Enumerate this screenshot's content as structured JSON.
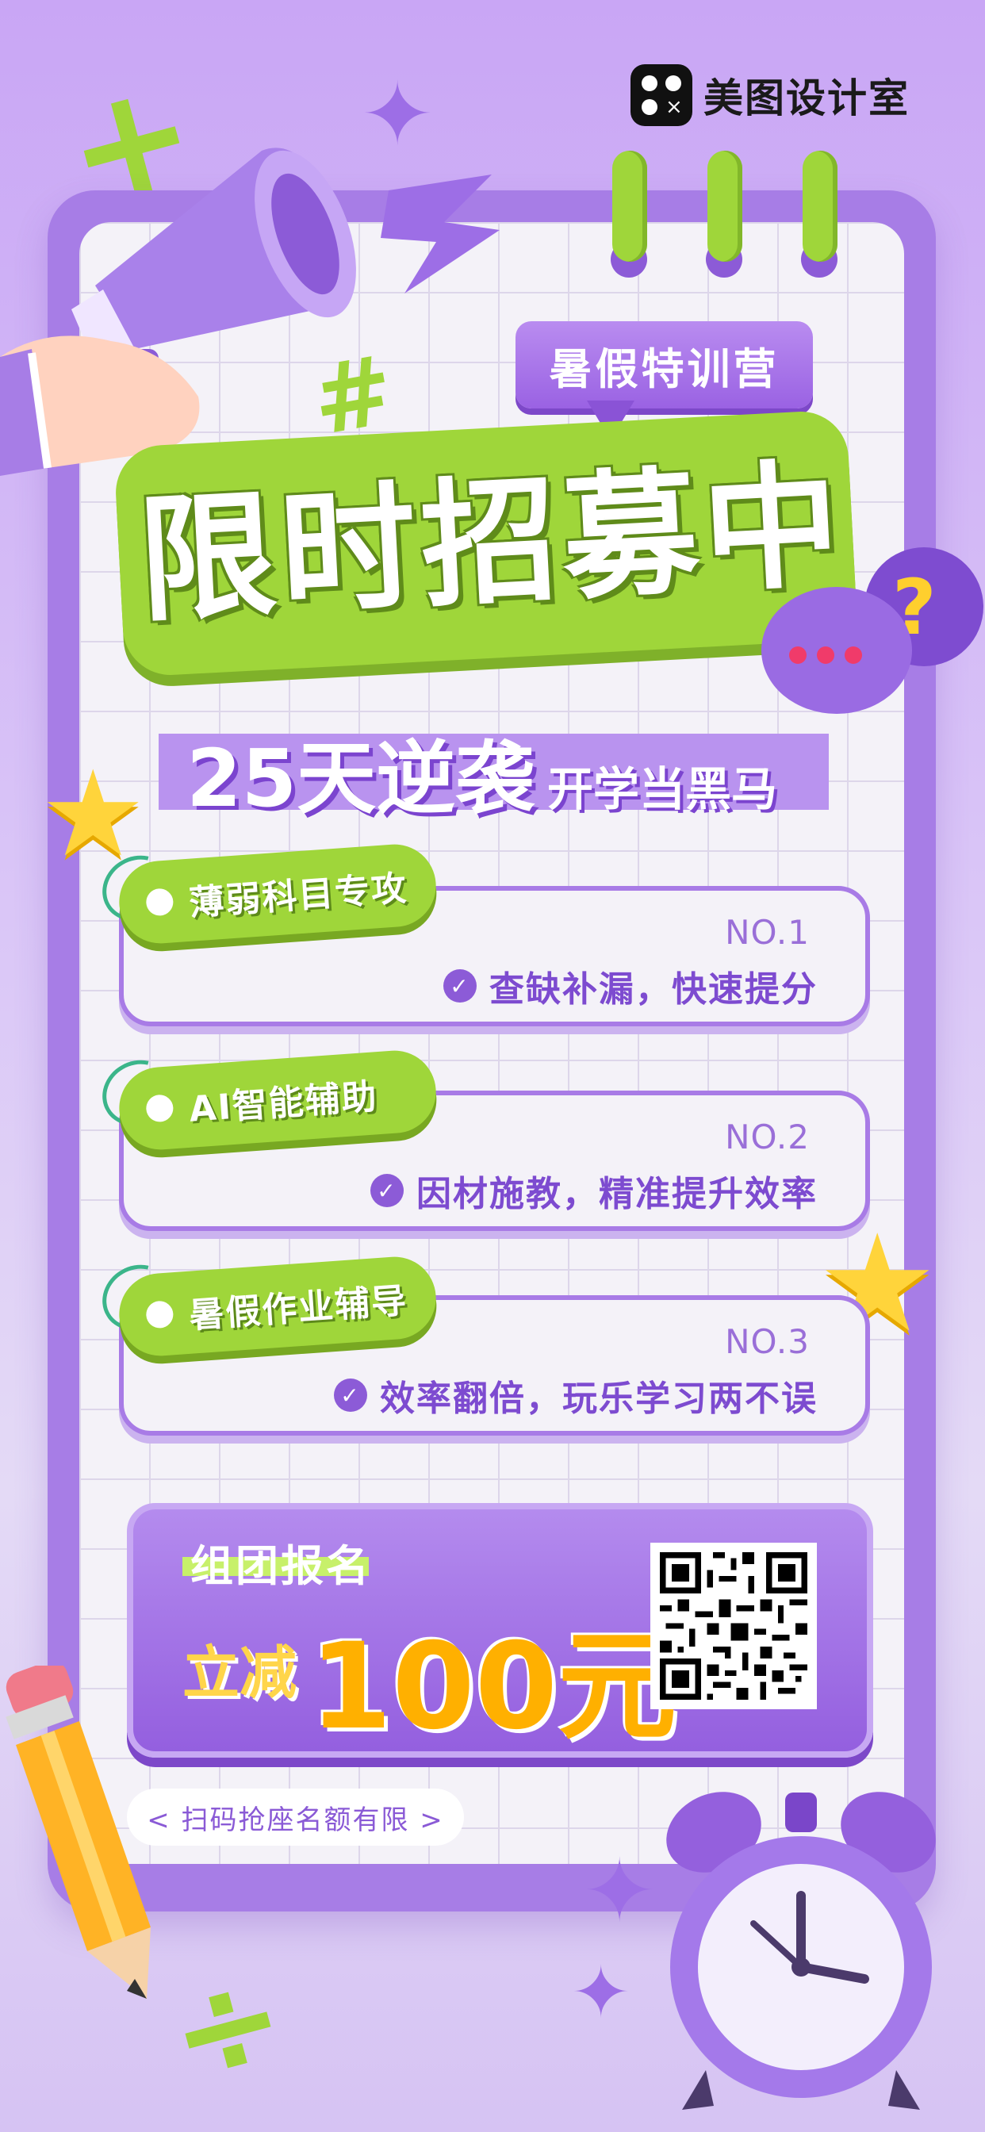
{
  "brand": {
    "name": "美图设计室",
    "logo_icon": "meitu-logo-icon"
  },
  "tag": "暑假特训营",
  "headline": "限时招募中",
  "subtitle": {
    "main": "25天逆袭",
    "side": "开学当黑马"
  },
  "features": [
    {
      "label": "薄弱科目专攻",
      "no": "NO.1",
      "desc": "查缺补漏，快速提分"
    },
    {
      "label": "AI智能辅助",
      "no": "NO.2",
      "desc": "因材施教，精准提升效率"
    },
    {
      "label": "暑假作业辅导",
      "no": "NO.3",
      "desc": "效率翻倍，玩乐学习两不误"
    }
  ],
  "promo": {
    "title": "组团报名",
    "lead": "立减",
    "amount": "100元"
  },
  "footer": "< 扫码抢座名额有限 >",
  "colors": {
    "purple": "#a77de6",
    "green": "#9fd63a",
    "yellow": "#ffd43b"
  },
  "decor_icons": [
    "megaphone-icon",
    "star-icon",
    "alarm-clock-icon",
    "pencil-icon",
    "speech-bubble-icon",
    "question-mark-icon",
    "lightning-icon",
    "hashtag-icon",
    "sparkle-icon"
  ]
}
